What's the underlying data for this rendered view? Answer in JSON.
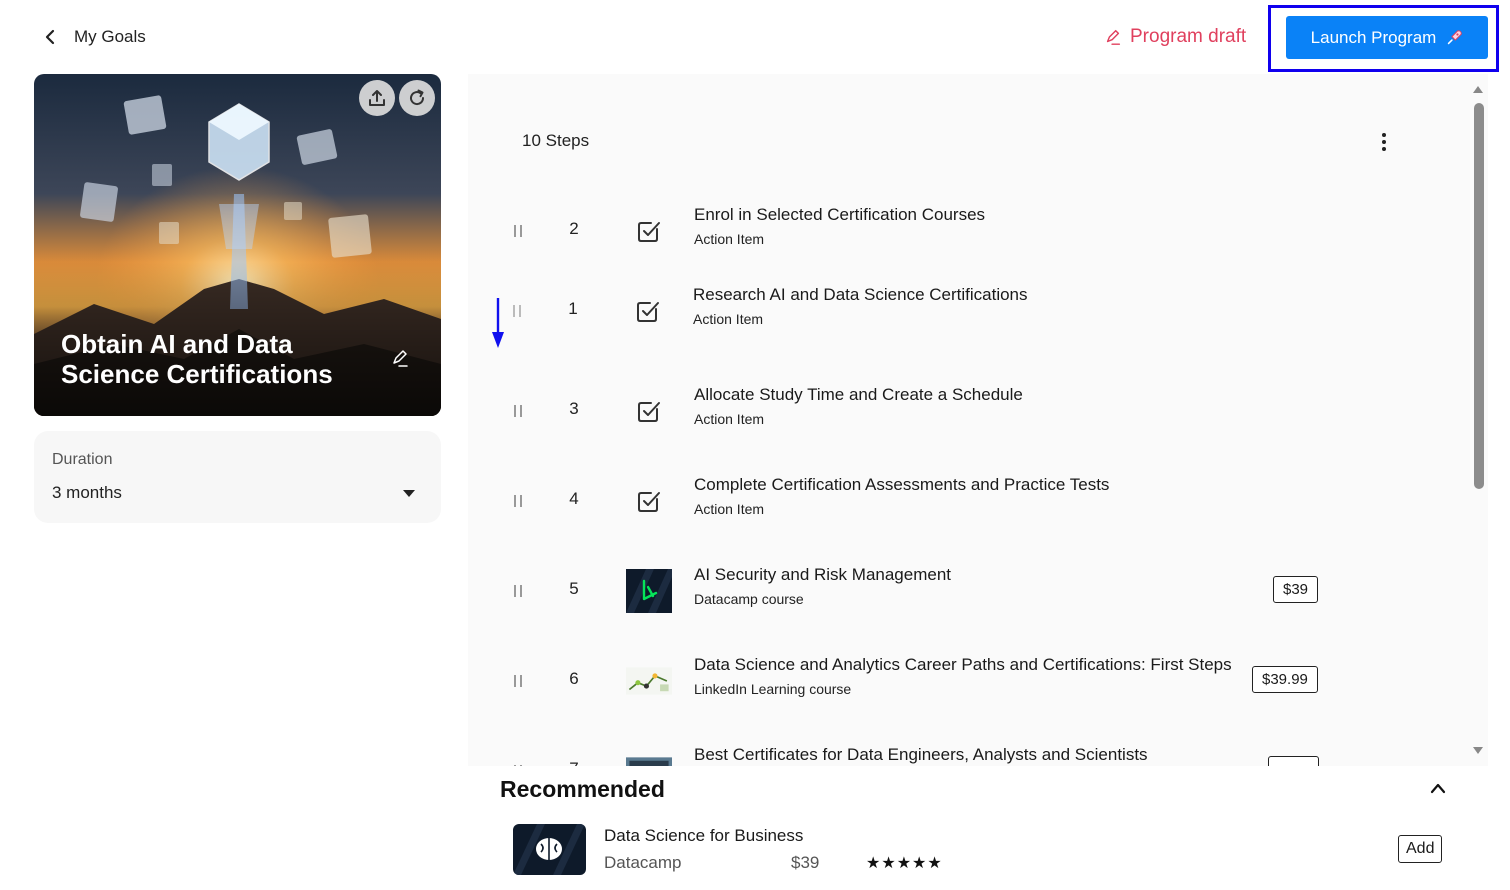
{
  "header": {
    "back_label": "My Goals",
    "draft_label": "Program draft",
    "launch_label": "Launch Program"
  },
  "goal": {
    "title": "Obtain AI and Data Science Certifications",
    "duration_label": "Duration",
    "duration_value": "3 months"
  },
  "steps": {
    "count_label": "10 Steps",
    "items": [
      {
        "number": "2",
        "title": "Enrol in Selected Certification Courses",
        "subtitle": "Action Item",
        "icon": "check-icon"
      },
      {
        "number": "1",
        "title": "Research AI and Data Science Certifications",
        "subtitle": "Action Item",
        "icon": "check-icon"
      },
      {
        "number": "3",
        "title": "Allocate Study Time and Create a Schedule",
        "subtitle": "Action Item",
        "icon": "check-icon"
      },
      {
        "number": "4",
        "title": "Complete Certification Assessments and Practice Tests",
        "subtitle": "Action Item",
        "icon": "check-icon"
      },
      {
        "number": "5",
        "title": "AI Security and Risk Management",
        "subtitle": "Datacamp course",
        "price": "$39",
        "icon": "course-thumbnail"
      },
      {
        "number": "6",
        "title": "Data Science and Analytics Career Paths and Certifications: First Steps",
        "subtitle": "LinkedIn Learning course",
        "price": "$39.99",
        "icon": "course-thumbnail"
      },
      {
        "number": "7",
        "title": "Best Certificates for Data Engineers, Analysts and Scientists",
        "subtitle": "",
        "icon": "course-thumbnail"
      }
    ]
  },
  "recommended": {
    "heading": "Recommended",
    "items": [
      {
        "title": "Data Science for Business",
        "provider": "Datacamp",
        "price": "$39",
        "stars": "★★★★★",
        "add_label": "Add"
      }
    ]
  },
  "colors": {
    "primary": "#0a82f7",
    "draft": "#e0405e",
    "highlight_outline": "#1000ee",
    "panel_bg": "#fafafa"
  }
}
